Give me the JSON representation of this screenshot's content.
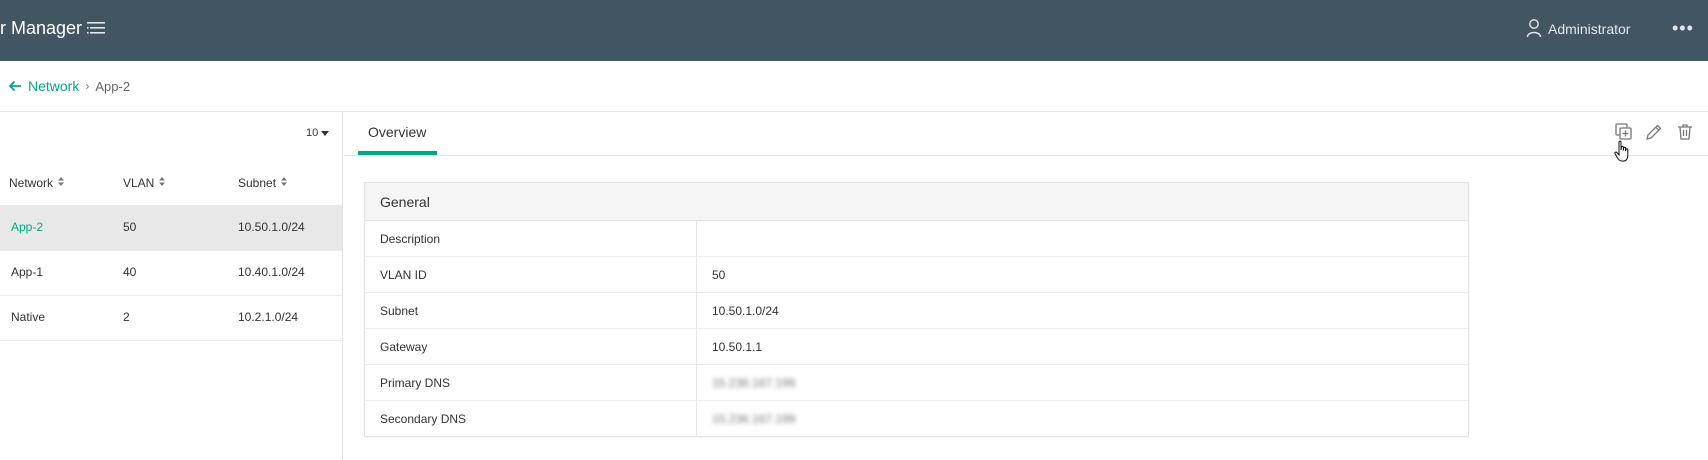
{
  "header": {
    "app_title": "r Manager",
    "user_label": "Administrator",
    "more_label": "•••"
  },
  "breadcrumb": {
    "parent": "Network",
    "separator": "›",
    "current": "App-2"
  },
  "list": {
    "page_size": "10",
    "columns": [
      "Network",
      "VLAN",
      "Subnet"
    ],
    "rows": [
      {
        "network": "App-2",
        "vlan": "50",
        "subnet": "10.50.1.0/24",
        "selected": true
      },
      {
        "network": "App-1",
        "vlan": "40",
        "subnet": "10.40.1.0/24",
        "selected": false
      },
      {
        "network": "Native",
        "vlan": "2",
        "subnet": "10.2.1.0/24",
        "selected": false
      }
    ]
  },
  "tabs": [
    {
      "label": "Overview",
      "active": true
    }
  ],
  "detail": {
    "section_title": "General",
    "rows": [
      {
        "label": "Description",
        "value": ""
      },
      {
        "label": "VLAN ID",
        "value": "50"
      },
      {
        "label": "Subnet",
        "value": "10.50.1.0/24"
      },
      {
        "label": "Gateway",
        "value": "10.50.1.1"
      },
      {
        "label": "Primary DNS",
        "value": "15.236.167.199"
      },
      {
        "label": "Secondary DNS",
        "value": "15.236.167.199"
      }
    ]
  },
  "icons": {
    "menu": "menu-icon",
    "user": "user-icon",
    "back": "arrow-left-icon",
    "clone": "clone-icon",
    "edit": "pencil-icon",
    "delete": "trash-icon",
    "sort": "sort-icon",
    "dropdown": "caret-down-icon"
  },
  "colors": {
    "header_bg": "#425563",
    "accent": "#01a982",
    "selected_row": "#e8e8e8"
  }
}
